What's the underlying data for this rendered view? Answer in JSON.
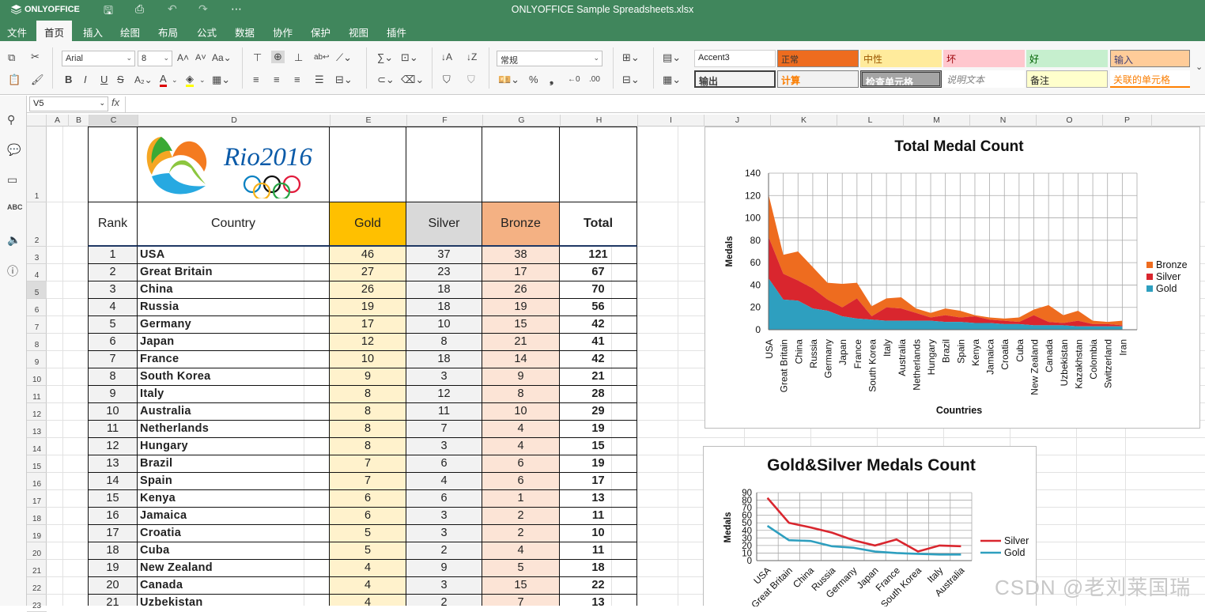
{
  "app": {
    "logo": "ONLYOFFICE",
    "doc_title": "ONLYOFFICE Sample Spreadsheets.xlsx"
  },
  "menu": [
    "文件",
    "首页",
    "插入",
    "绘图",
    "布局",
    "公式",
    "数据",
    "协作",
    "保护",
    "视图",
    "插件"
  ],
  "toolbar": {
    "font_name": "Arial",
    "font_size": "8",
    "number_format": "常规",
    "styles_row1": [
      "Accent3",
      "正常",
      "中性",
      "坏",
      "好",
      "输入"
    ],
    "styles_row2": [
      "输出",
      "计算",
      "检查单元格",
      "说明文本",
      "备注",
      "关联的单元格"
    ]
  },
  "formula_bar": {
    "cell_ref": "V5",
    "fx": "fx",
    "value": ""
  },
  "columns": [
    "A",
    "B",
    "C",
    "D",
    "E",
    "F",
    "G",
    "H",
    "I",
    "J",
    "K",
    "L",
    "M",
    "N",
    "O",
    "P"
  ],
  "rows": [
    "1",
    "2",
    "3",
    "4",
    "5",
    "6",
    "7",
    "8",
    "9",
    "10",
    "11",
    "12",
    "13",
    "14",
    "15",
    "16",
    "17",
    "18",
    "19",
    "20",
    "21",
    "22",
    "23"
  ],
  "selected_row": "5",
  "table": {
    "headers": {
      "rank": "Rank",
      "country": "Country",
      "gold": "Gold",
      "silver": "Silver",
      "bronze": "Bronze",
      "total": "Total"
    },
    "logo_text": "Rio2016",
    "rows": [
      [
        "1",
        "USA",
        "46",
        "37",
        "38",
        "121"
      ],
      [
        "2",
        "Great Britain",
        "27",
        "23",
        "17",
        "67"
      ],
      [
        "3",
        "China",
        "26",
        "18",
        "26",
        "70"
      ],
      [
        "4",
        "Russia",
        "19",
        "18",
        "19",
        "56"
      ],
      [
        "5",
        "Germany",
        "17",
        "10",
        "15",
        "42"
      ],
      [
        "6",
        "Japan",
        "12",
        "8",
        "21",
        "41"
      ],
      [
        "7",
        "France",
        "10",
        "18",
        "14",
        "42"
      ],
      [
        "8",
        "South Korea",
        "9",
        "3",
        "9",
        "21"
      ],
      [
        "9",
        "Italy",
        "8",
        "12",
        "8",
        "28"
      ],
      [
        "10",
        "Australia",
        "8",
        "11",
        "10",
        "29"
      ],
      [
        "11",
        "Netherlands",
        "8",
        "7",
        "4",
        "19"
      ],
      [
        "12",
        "Hungary",
        "8",
        "3",
        "4",
        "15"
      ],
      [
        "13",
        "Brazil",
        "7",
        "6",
        "6",
        "19"
      ],
      [
        "14",
        "Spain",
        "7",
        "4",
        "6",
        "17"
      ],
      [
        "15",
        "Kenya",
        "6",
        "6",
        "1",
        "13"
      ],
      [
        "16",
        "Jamaica",
        "6",
        "3",
        "2",
        "11"
      ],
      [
        "17",
        "Croatia",
        "5",
        "3",
        "2",
        "10"
      ],
      [
        "18",
        "Cuba",
        "5",
        "2",
        "4",
        "11"
      ],
      [
        "19",
        "New Zealand",
        "4",
        "9",
        "5",
        "18"
      ],
      [
        "20",
        "Canada",
        "4",
        "3",
        "15",
        "22"
      ],
      [
        "21",
        "Uzbekistan",
        "4",
        "2",
        "7",
        "13"
      ]
    ]
  },
  "colors": {
    "brand": "#40865c",
    "gold": "#ffc000",
    "silver": "#d9d9d9",
    "bronze": "#f4b183",
    "gold_series": "#2e9fbf",
    "silver_series": "#d9262e",
    "bronze_series": "#ee6c1f"
  },
  "chart_data": [
    {
      "type": "area",
      "stacked": true,
      "title": "Total Medal Count",
      "xlabel": "Countries",
      "ylabel": "Medals",
      "ylim": [
        0,
        140
      ],
      "yticks": [
        "0",
        "20",
        "40",
        "60",
        "80",
        "100",
        "120",
        "140"
      ],
      "grid": true,
      "legend": "right",
      "categories": [
        "USA",
        "Great Britain",
        "China",
        "Russia",
        "Germany",
        "Japan",
        "France",
        "South Korea",
        "Italy",
        "Australia",
        "Netherlands",
        "Hungary",
        "Brazil",
        "Spain",
        "Kenya",
        "Jamaica",
        "Croatia",
        "Cuba",
        "New Zealand",
        "Canada",
        "Uzbekistan",
        "Kazakhstan",
        "Colombia",
        "Switzerland",
        "Iran"
      ],
      "series": [
        {
          "name": "Gold",
          "color": "#2e9fbf",
          "values": [
            46,
            27,
            26,
            19,
            17,
            12,
            10,
            9,
            8,
            8,
            8,
            8,
            7,
            7,
            6,
            6,
            5,
            5,
            4,
            4,
            4,
            3,
            3,
            3,
            3
          ]
        },
        {
          "name": "Silver",
          "color": "#d9262e",
          "values": [
            37,
            23,
            18,
            18,
            10,
            8,
            18,
            3,
            12,
            11,
            7,
            3,
            6,
            4,
            6,
            3,
            3,
            2,
            9,
            3,
            2,
            5,
            2,
            2,
            1
          ]
        },
        {
          "name": "Bronze",
          "color": "#ee6c1f",
          "values": [
            38,
            17,
            26,
            19,
            15,
            21,
            14,
            9,
            8,
            10,
            4,
            4,
            6,
            6,
            1,
            2,
            2,
            4,
            5,
            15,
            7,
            9,
            3,
            2,
            4
          ]
        }
      ]
    },
    {
      "type": "line",
      "title": "Gold&Silver Medals Count",
      "xlabel": "",
      "ylabel": "Medals",
      "ylim": [
        0,
        90
      ],
      "yticks": [
        "0",
        "10",
        "20",
        "30",
        "40",
        "50",
        "60",
        "70",
        "80",
        "90"
      ],
      "grid": true,
      "legend": "right",
      "categories": [
        "USA",
        "Great Britain",
        "China",
        "Russia",
        "Germany",
        "Japan",
        "France",
        "South Korea",
        "Italy",
        "Australia"
      ],
      "series": [
        {
          "name": "Silver",
          "color": "#d9262e",
          "values": [
            83,
            50,
            44,
            37,
            27,
            20,
            28,
            12,
            20,
            19
          ]
        },
        {
          "name": "Gold",
          "color": "#2e9fbf",
          "values": [
            46,
            27,
            26,
            19,
            17,
            12,
            10,
            9,
            8,
            8
          ]
        }
      ]
    }
  ],
  "watermark": "CSDN @老刘莱国瑞"
}
